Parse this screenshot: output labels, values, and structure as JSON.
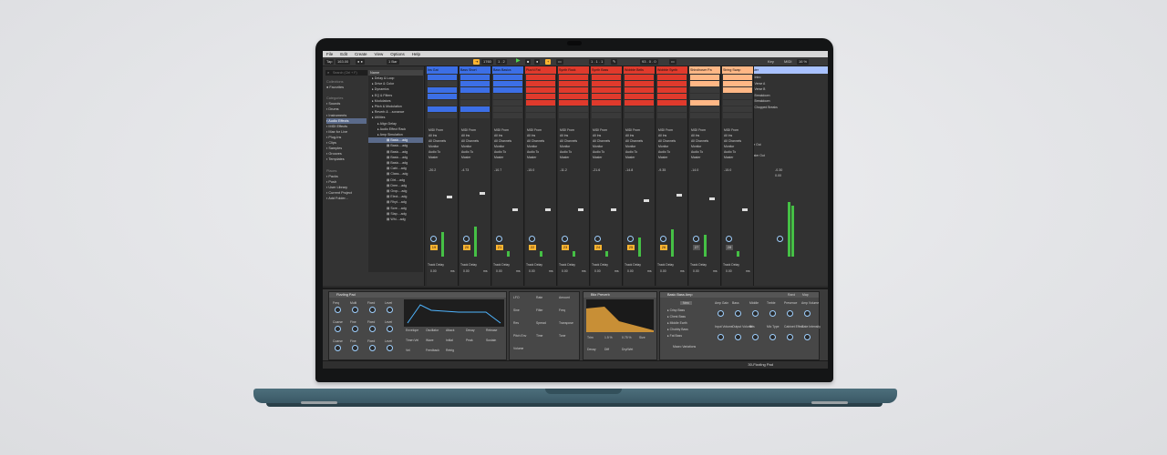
{
  "menu": [
    "File",
    "Edit",
    "Create",
    "View",
    "Options",
    "Help"
  ],
  "transport": {
    "tap": "Tap",
    "tempo": "163.00",
    "bar_setting": "1 Bar",
    "position": "1760",
    "pos_beats": "1 . 2",
    "loop": "1 . 1 . 1",
    "loop_len": "93 . 0 . 0",
    "key_label": "Key",
    "midi_label": "MIDI",
    "cpu": "16 %"
  },
  "browser": {
    "search_placeholder": "Search (Ctrl + F)",
    "collections_header": "Collections",
    "favorites": "Favorites",
    "categories_header": "Categories",
    "categories": [
      "Sounds",
      "Drums",
      "Instruments",
      "Audio Effects",
      "MIDI Effects",
      "Max for Live",
      "Plug-Ins",
      "Clips",
      "Samples",
      "Grooves",
      "Templates"
    ],
    "places_header": "Places",
    "places": [
      "Packs",
      "Push",
      "User Library",
      "Current Project",
      "Add Folder..."
    ],
    "name_header": "Name",
    "items": [
      "Delay & Loop",
      "Drive & Color",
      "Dynamics",
      "EQ & Filters",
      "Modulators",
      "Pitch & Modulation",
      "Reverb & ...sonance",
      "Utilities",
      "Align Delay",
      "Audio Effect Rack",
      "Amp Simulation"
    ],
    "sub_items": [
      "Basic....adg",
      "Basic....adg",
      "Basic....adg",
      "Basic....adg",
      "Basic....adg",
      "Cabi....adg",
      "Class....adg",
      "Dirt....adg",
      "Dree....adg",
      "Grop....adg",
      "Elect....adg",
      "Rhyt....adg",
      "Scre....adg",
      "Slap....adg",
      "Whi....adg"
    ]
  },
  "tracks": [
    {
      "name": "Ins Gat",
      "color": "#3c6fe6",
      "vol": "-20.2",
      "num": "19"
    },
    {
      "name": "Bass Short",
      "color": "#3c6fe6",
      "vol": "-4.73",
      "num": "20"
    },
    {
      "name": "Bass Basics",
      "color": "#3c6fe6",
      "vol": "-10.7",
      "num": "21"
    },
    {
      "name": "Pizz'd Fat",
      "color": "#e03a2c",
      "vol": "-15.0",
      "num": "22"
    },
    {
      "name": "Synth Rock",
      "color": "#e03a2c",
      "vol": "-11.2",
      "num": "23"
    },
    {
      "name": "Synth Bass",
      "color": "#e03a2c",
      "vol": "-21.6",
      "num": "24"
    },
    {
      "name": "Wobble Bells",
      "color": "#e03a2c",
      "vol": "-14.8",
      "num": "25"
    },
    {
      "name": "Wobble Synth",
      "color": "#e03a2c",
      "vol": "-9.35",
      "num": "26"
    },
    {
      "name": "Shiroihoser Pa",
      "color": "#ffb785",
      "vol": "-14.0",
      "num": "27"
    },
    {
      "name": "String Swap",
      "color": "#ffb785",
      "vol": "-15.0",
      "num": "28"
    }
  ],
  "mixer": {
    "midi_from": "MIDI From",
    "all_ins": "All Ins",
    "all_channels": "All Channels",
    "monitor": "Monitor",
    "in": "In",
    "auto": "Auto",
    "off": "Off",
    "audio_to": "Audio To",
    "master": "Master",
    "track_delay": "Track Delay",
    "delay_value": "0.00",
    "ms": "ms"
  },
  "master": {
    "title": "Master",
    "scenes": [
      "Intro",
      "Verse A",
      "Verse B",
      "Breakdown",
      "Breakdown",
      "Chopped Breaks"
    ],
    "cue_out": "Cue Out",
    "cue_val": "1/2",
    "master_out": "Master Out",
    "master_val": "1/2",
    "vol": "-0.30",
    "vol2": "0.00"
  },
  "devices": {
    "fizzling": {
      "title": "Fizzling Pad",
      "params": [
        "Freq",
        "Multi",
        "Fixed",
        "Level",
        "Coarse",
        "Fine",
        "Fixed",
        "Level",
        "Coarse",
        "Fine",
        "Fixed",
        "Level"
      ],
      "values": [
        "-9.2 dB",
        "1.80",
        "0",
        "0"
      ],
      "env_labels": [
        "Envelope",
        "Oscillator",
        "Attack",
        "Decay",
        "Release",
        "Time<Vel",
        "Wave",
        "Initial",
        "Peak",
        "Sustain",
        "Vel",
        "Feedback",
        "Retrig"
      ]
    },
    "lfo": {
      "labels": [
        "LFO",
        "Rate",
        "Amount",
        "Sine",
        "Filter",
        "Freq",
        "Res",
        "Spread",
        "Transpose",
        "Pitch Env",
        "Time",
        "Tone",
        "Volume"
      ]
    },
    "blitz": {
      "title": "Bitz Preverb",
      "labels": [
        "Trim",
        "1.5 %",
        "0.75 %",
        "Size",
        "Decay",
        "Diff",
        "Dry/Wet"
      ]
    },
    "amp": {
      "title": "Basic Bass Amp",
      "new_label": "New",
      "presets": [
        "Crisp Bass",
        "Chest Bass",
        "Middle Earth",
        "Chubby Bass",
        "Fat Bass"
      ],
      "macro": "Macro Variations",
      "params": [
        "Amp Gain",
        "Bass",
        "Middle",
        "Treble",
        "Presence",
        "Amp Volume",
        "Input Volume",
        "Output Volume",
        "Bits",
        "Mic Type",
        "Cabinet Effect",
        "Gate Intensity"
      ],
      "values": [
        "3.89",
        "-4.00 dB",
        "0.0",
        "0.0"
      ],
      "rand": "Rand",
      "map": "Map"
    }
  },
  "status": {
    "selected": "30-Fizzling Pad"
  },
  "colors": {
    "accent": "#ffb531",
    "blue": "#3c6fe6",
    "red": "#e03a2c",
    "peach": "#ffb785",
    "meter": "#45c045"
  }
}
